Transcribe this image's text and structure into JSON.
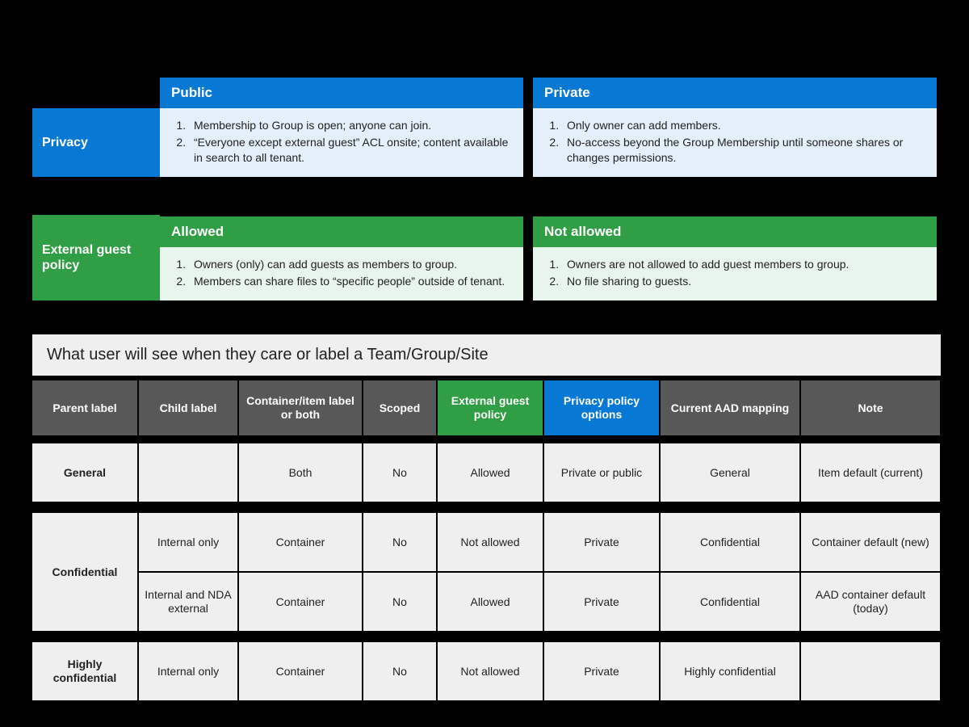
{
  "privacy": {
    "rowLabel": "Privacy",
    "left": {
      "header": "Public",
      "items": [
        "Membership to Group is open; anyone can join.",
        "“Everyone except external guest” ACL onsite; content available in search to all tenant."
      ]
    },
    "right": {
      "header": "Private",
      "items": [
        "Only owner can add members.",
        "No-access beyond the Group Membership until someone shares or changes permissions."
      ]
    }
  },
  "guest": {
    "rowLabel": "External guest policy",
    "left": {
      "header": "Allowed",
      "items": [
        "Owners (only) can add guests as members to group.",
        "Members can share files to “specific people” outside of tenant."
      ]
    },
    "right": {
      "header": "Not allowed",
      "items": [
        "Owners are not allowed to add guest members to group.",
        "No file sharing to guests."
      ]
    }
  },
  "lower": {
    "caption": "What user will see when they care or label a Team/Group/Site",
    "columns": [
      "Parent label",
      "Child label",
      "Container/item label or both",
      "Scoped",
      "External guest policy",
      "Privacy policy options",
      "Current AAD mapping",
      "Note"
    ],
    "rows": [
      {
        "parent": "General",
        "child": "",
        "type": "Both",
        "scoped": "No",
        "guest": "Allowed",
        "privacy": "Private or public",
        "aad": "General",
        "note": "Item default (current)"
      },
      {
        "parent": "Confidential",
        "child": "Internal only",
        "type": "Container",
        "scoped": "No",
        "guest": "Not allowed",
        "privacy": "Private",
        "aad": "Confidential",
        "note": "Container default (new)"
      },
      {
        "parent": "",
        "child": "Internal and NDA external",
        "type": "Container",
        "scoped": "No",
        "guest": "Allowed",
        "privacy": "Private",
        "aad": "Confidential",
        "note": "AAD container default (today)"
      },
      {
        "parent": "Highly confidential",
        "child": "Internal only",
        "type": "Container",
        "scoped": "No",
        "guest": "Not allowed",
        "privacy": "Private",
        "aad": "Highly confidential",
        "note": ""
      }
    ]
  }
}
